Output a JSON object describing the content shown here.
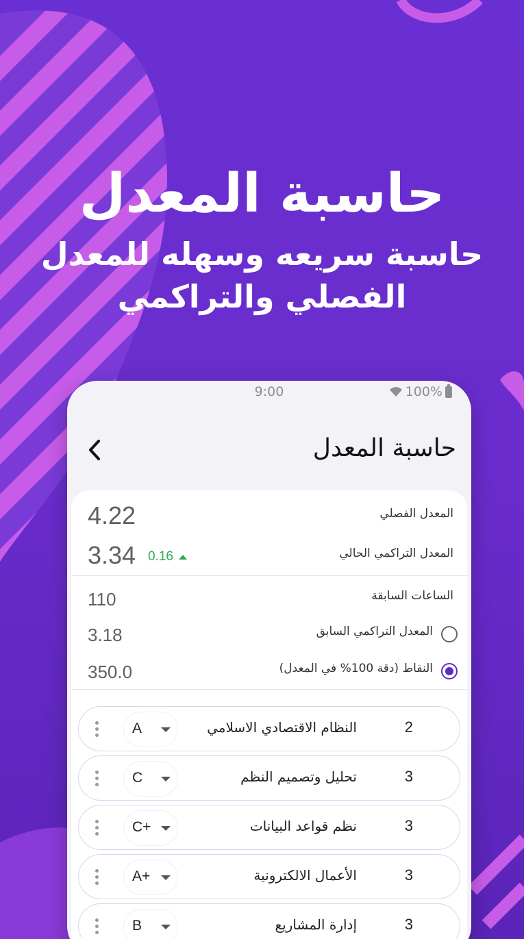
{
  "promo": {
    "headline": "حاسبة المعدل",
    "subline": "حاسبة سريعه وسهله للمعدل الفصلي والتراكمي"
  },
  "status_bar": {
    "time": "9:00",
    "battery": "100%"
  },
  "app_bar": {
    "title": "حاسبة المعدل",
    "back_icon": "chevron-left-icon"
  },
  "summary": {
    "semester_gpa_label": "المعدل الفصلي",
    "semester_gpa_value": "4.22",
    "cumulative_gpa_label": "المعدل التراكمي الحالي",
    "cumulative_gpa_value": "3.34",
    "change_value": "0.16"
  },
  "previous": {
    "hours_label": "الساعات السابقة",
    "hours_value": "110",
    "prev_gpa_label": "المعدل التراكمي السابق",
    "prev_gpa_value": "3.18",
    "points_label": "النقاط (دقة 100% في المعدل)",
    "points_value": "350.0",
    "selected_option": "points"
  },
  "courses": [
    {
      "name": "النظام الاقتصادي الاسلامي",
      "hours": "2",
      "grade": "A"
    },
    {
      "name": "تحليل وتصميم النظم",
      "hours": "3",
      "grade": "C"
    },
    {
      "name": "نظم قواعد البيانات",
      "hours": "3",
      "grade": "C+"
    },
    {
      "name": "الأعمال الالكترونية",
      "hours": "3",
      "grade": "A+"
    },
    {
      "name": "إدارة المشاريع",
      "hours": "3",
      "grade": "B"
    }
  ],
  "colors": {
    "background": "#6a2fd2",
    "stripe": "#c65ce8",
    "accent": "#5a2fc0",
    "positive": "#32a852"
  }
}
